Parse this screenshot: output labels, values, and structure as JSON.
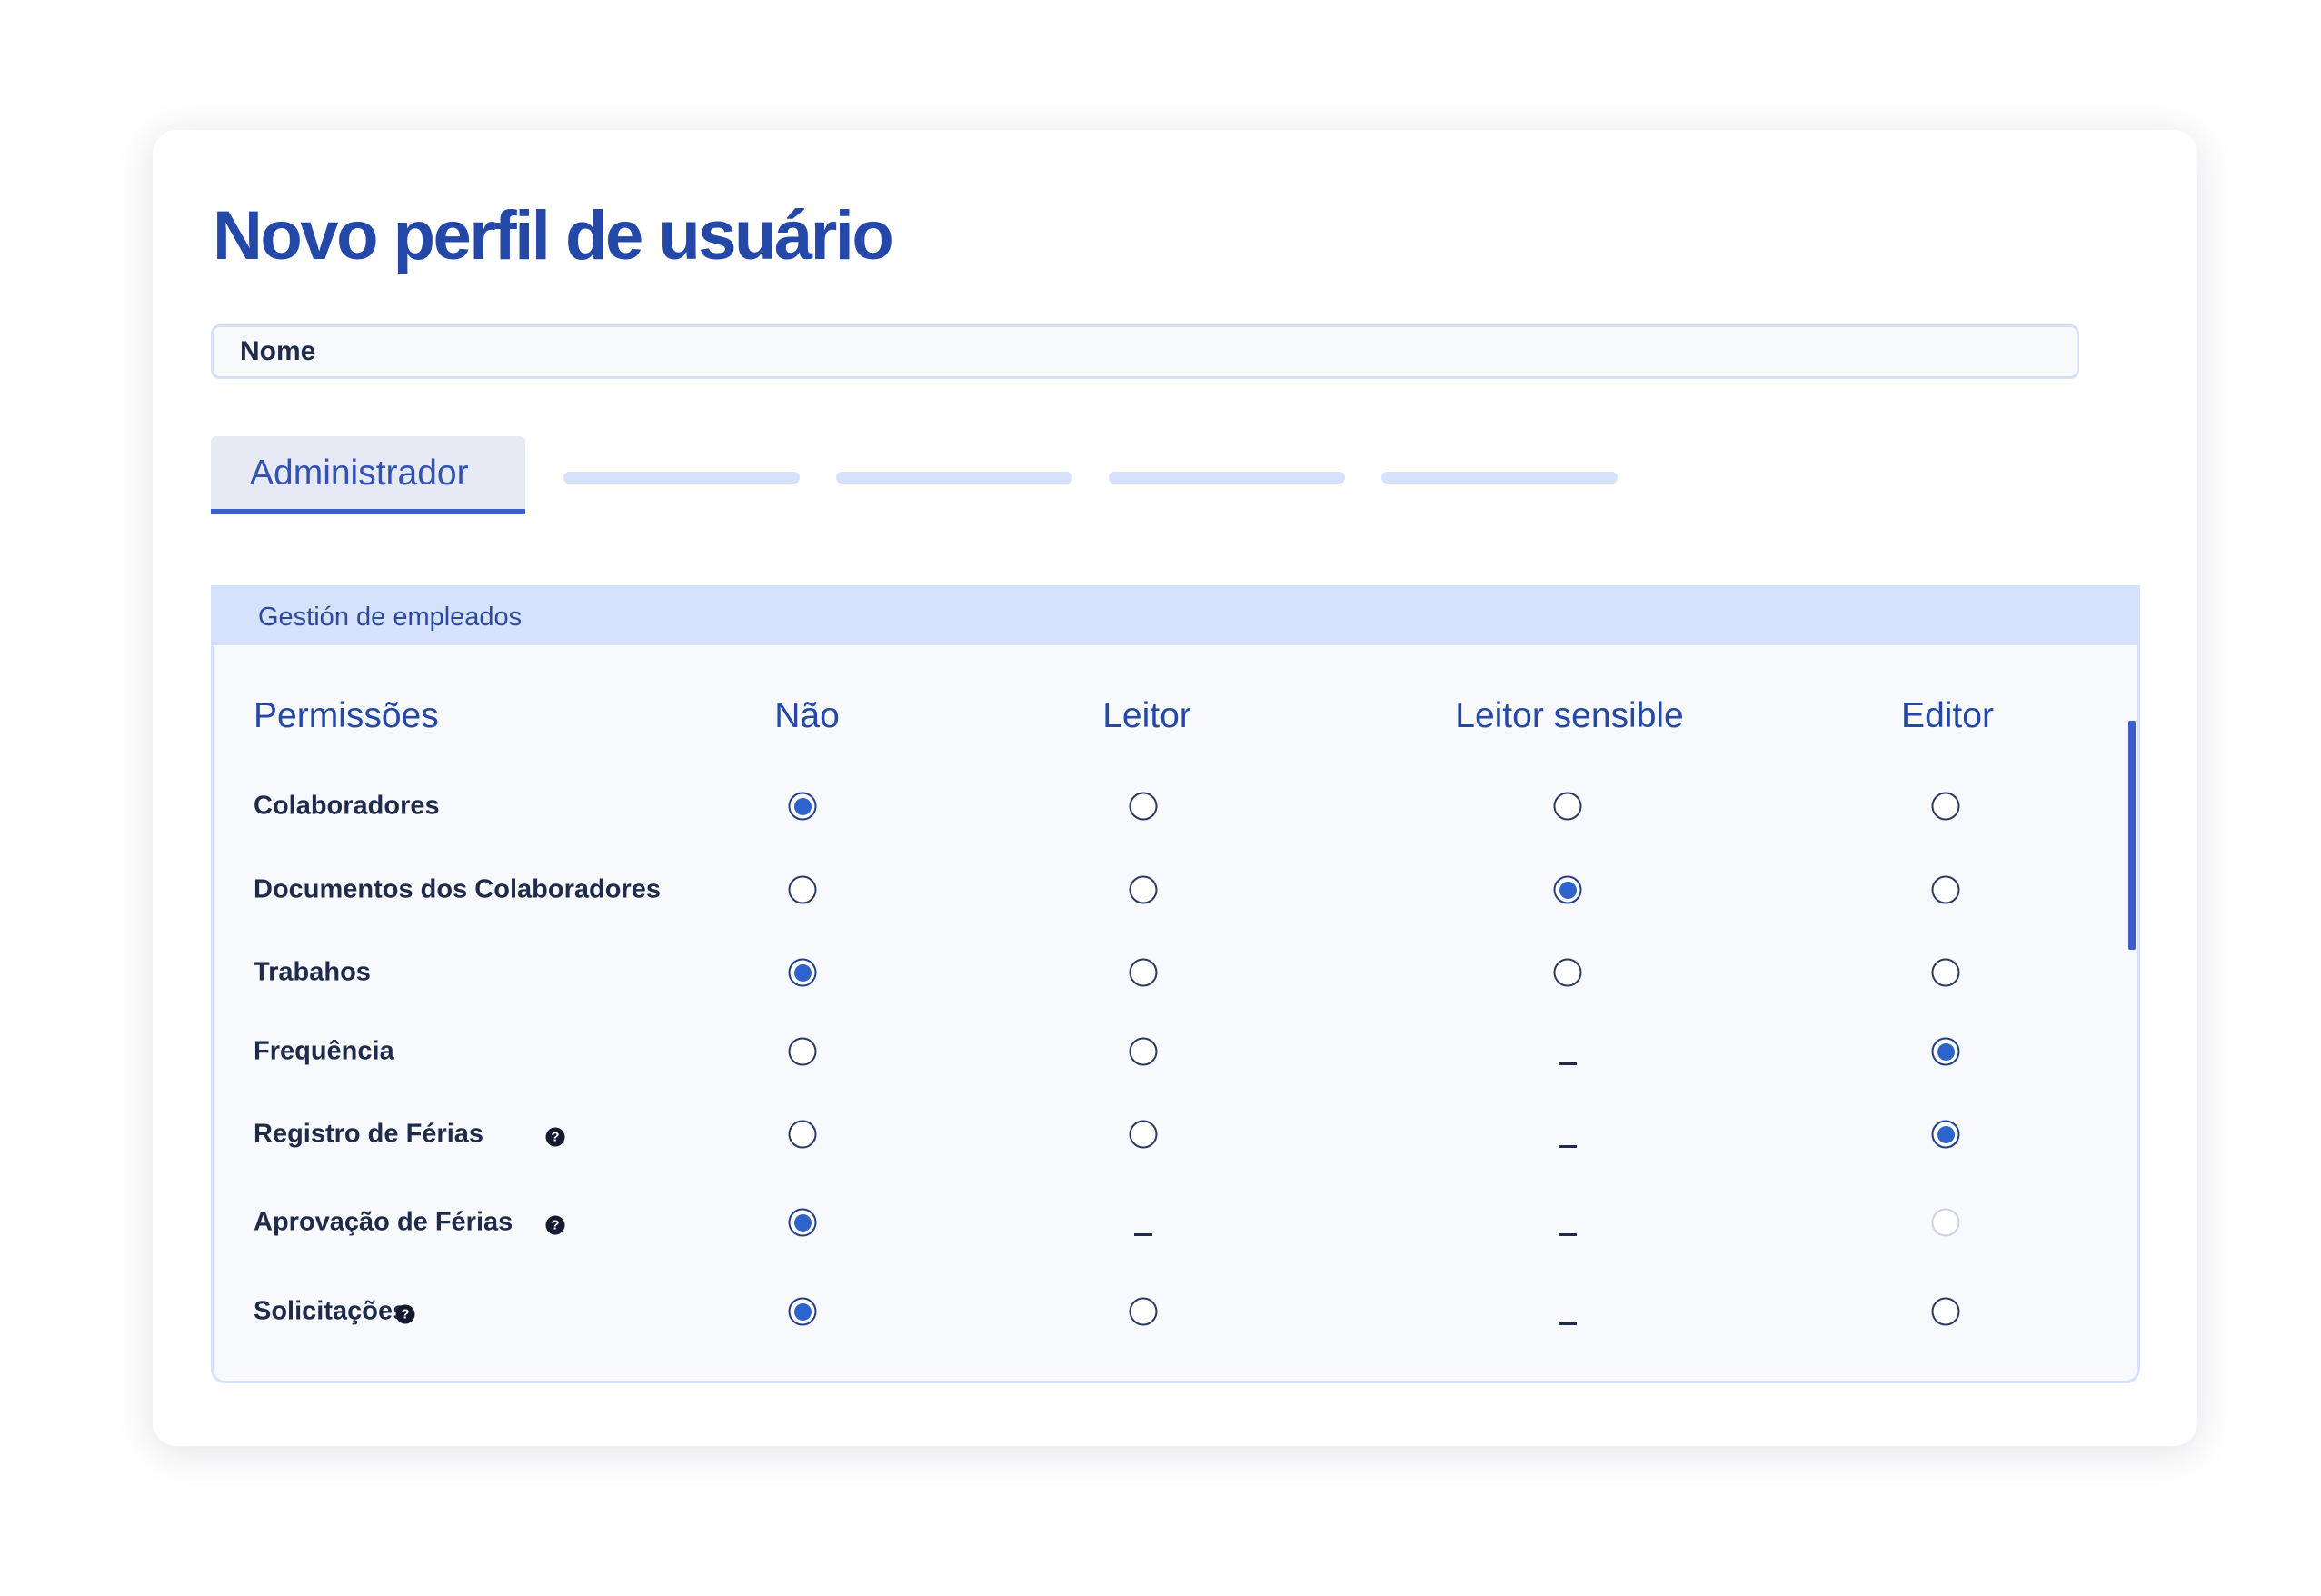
{
  "title": "Novo perfil de usuário",
  "name_field": {
    "placeholder": "Nome"
  },
  "tabs": {
    "active_label": "Administrador",
    "placeholder_tab_count": 4
  },
  "section": {
    "title": "Gestión de empleados",
    "columns": [
      "Permissões",
      "Não",
      "Leitor",
      "Leitor sensible",
      "Editor"
    ],
    "rows": [
      {
        "label": "Colaboradores",
        "help": false,
        "cells": [
          "checked",
          "unchecked",
          "unchecked",
          "unchecked"
        ]
      },
      {
        "label": "Documentos dos Colaboradores",
        "help": false,
        "cells": [
          "unchecked",
          "unchecked",
          "checked",
          "unchecked"
        ]
      },
      {
        "label": "Trabahos",
        "help": false,
        "cells": [
          "checked",
          "unchecked",
          "unchecked",
          "unchecked"
        ]
      },
      {
        "label": "Frequência",
        "help": false,
        "cells": [
          "unchecked",
          "unchecked",
          "none",
          "checked"
        ]
      },
      {
        "label": "Registro de Férias",
        "help": true,
        "cells": [
          "unchecked",
          "unchecked",
          "none",
          "checked"
        ]
      },
      {
        "label": "Aprovação de Férias",
        "help": true,
        "cells": [
          "checked",
          "none",
          "none",
          "disabled"
        ]
      },
      {
        "label": "Solicitações",
        "help": true,
        "cells": [
          "checked",
          "unchecked",
          "none",
          "unchecked"
        ]
      }
    ]
  },
  "colors": {
    "accent": "#2348a8",
    "tab_underline": "#3a5fcc",
    "header_band": "#d6e1fb",
    "radio_fill": "#2d63cc",
    "text_dark": "#1e2b4a"
  },
  "icons": [
    "help-icon",
    "radio-button-icon",
    "dash-icon"
  ]
}
